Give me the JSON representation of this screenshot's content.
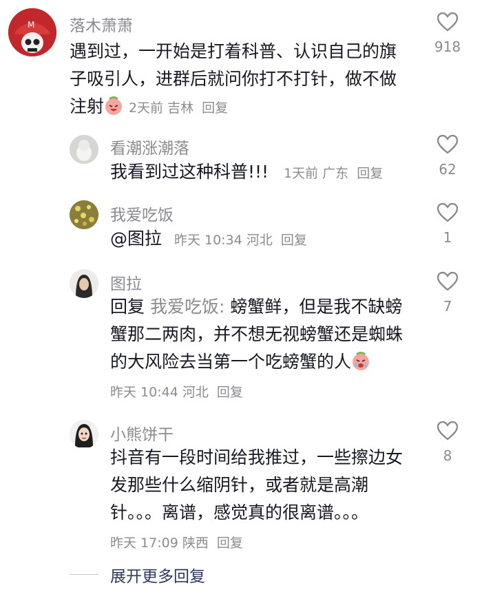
{
  "comments": [
    {
      "username": "落木萧萧",
      "text_lines": [
        "遇到过，一开始是打着科普、认识自己的旗",
        "子吸引人，进群后就问你打不打针，做不做",
        "注射"
      ],
      "meta": "2天前 吉林",
      "reply_label": "回复",
      "likes": "918",
      "avatar_icon": "skull-cap-avatar"
    },
    {
      "username": "看潮涨潮落",
      "text": "我看到过这种科普!!!",
      "meta": "1天前 广东",
      "reply_label": "回复",
      "likes": "62"
    },
    {
      "username": "我爱吃饭",
      "mention": "@图拉",
      "meta": "昨天 10:34 河北",
      "reply_label": "回复",
      "likes": "1"
    },
    {
      "username": "图拉",
      "reply_prefix": "回复",
      "reply_target": "我爱吃饭:",
      "text_lines": [
        " 螃蟹鲜，但是我不缺螃",
        "蟹那二两肉，并不想无视螃蟹还是蜘蛛",
        "的大风险去当第一个吃螃蟹的人"
      ],
      "meta": "昨天 10:44 河北",
      "reply_label": "回复",
      "likes": "7"
    },
    {
      "username": "小熊饼干",
      "text_lines": [
        "抖音有一段时间给我推过，一些擦边女",
        "发那些什么缩阴针，或者就是高潮",
        "针。。。离谱，感觉真的很离谱。。。"
      ],
      "meta": "昨天 17:09 陕西",
      "reply_label": "回复",
      "likes": "8"
    }
  ],
  "expand_label": "展开更多回复",
  "colors": {
    "username": "#8a8b91",
    "text": "#161823",
    "expand": "#2b3a5a"
  }
}
